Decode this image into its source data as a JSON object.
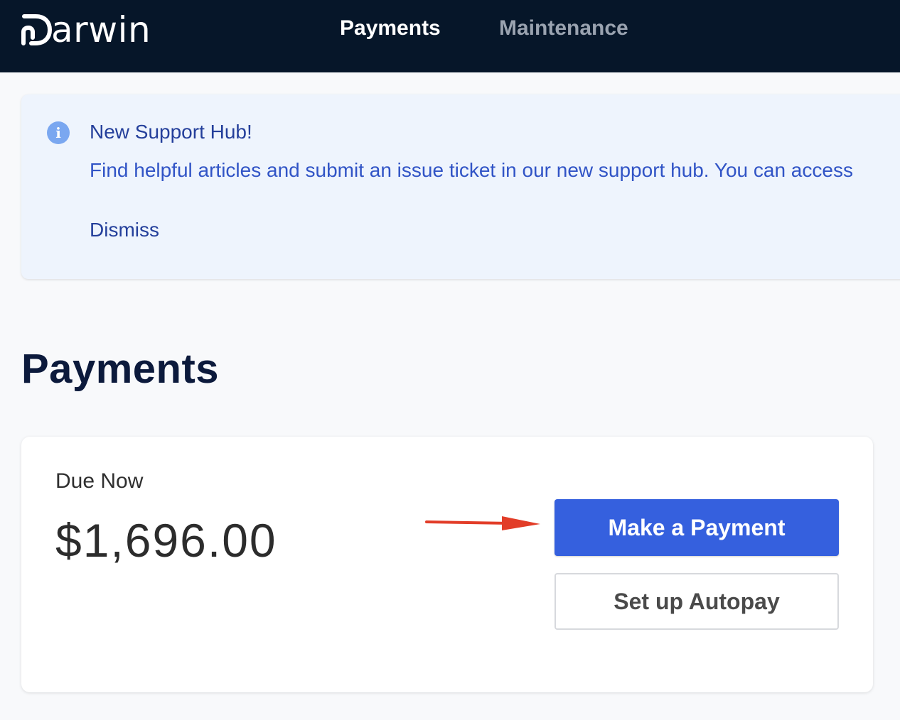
{
  "header": {
    "brand": "Darwin",
    "nav": [
      {
        "label": "Payments",
        "active": true
      },
      {
        "label": "Maintenance",
        "active": false
      }
    ]
  },
  "banner": {
    "title": "New Support Hub!",
    "body": "Find helpful articles and submit an issue ticket in our new support hub. You can access",
    "dismiss_label": "Dismiss",
    "icon": "info-icon"
  },
  "page": {
    "title": "Payments"
  },
  "payment_card": {
    "due_label": "Due Now",
    "due_amount": "$1,696.00",
    "make_payment_label": "Make a Payment",
    "autopay_label": "Set up Autopay"
  },
  "colors": {
    "header_bg": "#061629",
    "primary_button": "#3560de",
    "banner_bg": "#eef4fd",
    "annotation_arrow": "#e23d28"
  }
}
